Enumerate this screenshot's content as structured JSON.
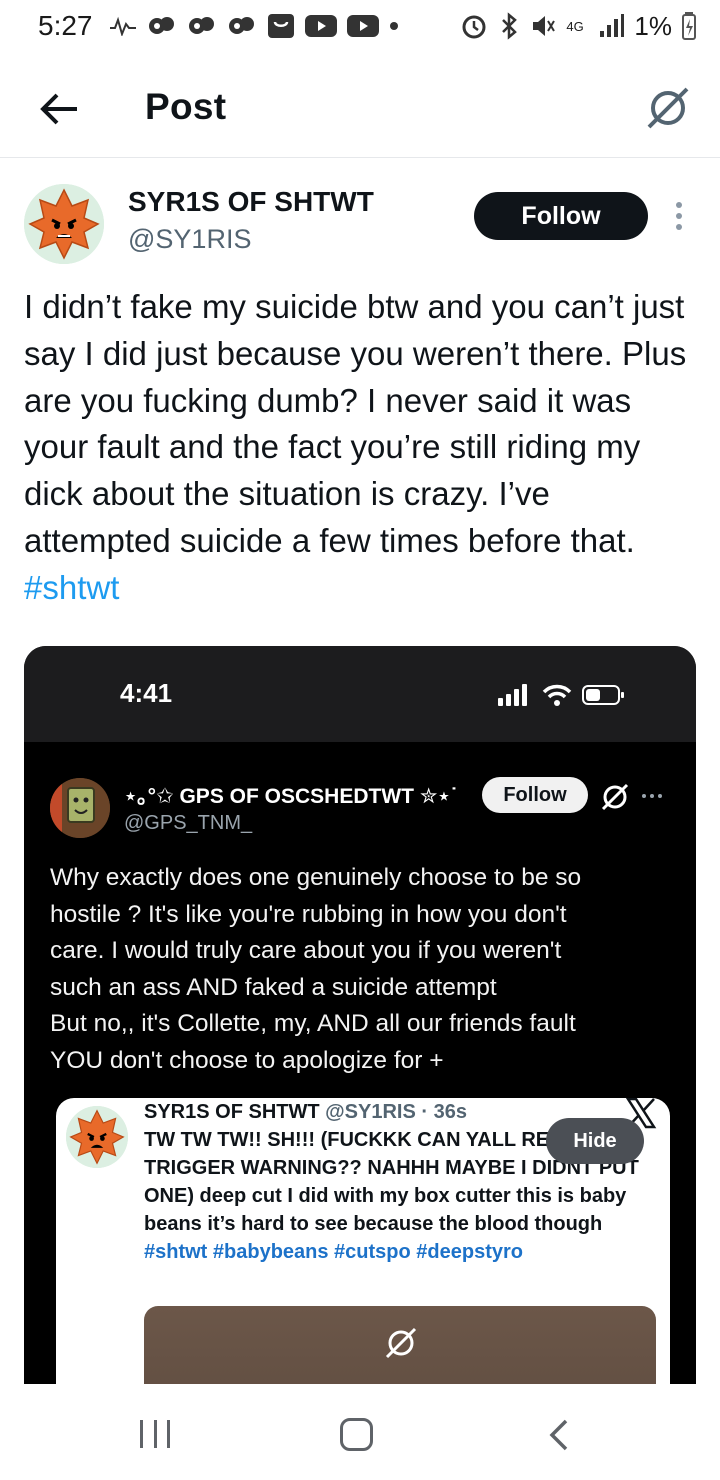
{
  "status_bar": {
    "time": "5:27",
    "network": "4G",
    "battery": "1%"
  },
  "header": {
    "title": "Post"
  },
  "post": {
    "author_name": "SYR1S OF SHTWT",
    "author_handle": "@SY1RIS",
    "follow_label": "Follow",
    "text": "I didn’t fake my suicide btw and you can’t just say I did just because you weren’t there. Plus are you fucking dumb? I never said it was your fault and the fact you’re still riding my dick about the situation is crazy. I’ve attempted suicide a few times before that. ",
    "hashtag": "#shtwt"
  },
  "embedded_screenshot": {
    "time": "4:41",
    "author_name": "⋆｡°✩ GPS OF OSCSHEDTWT ✮⋆˙",
    "author_handle": "@GPS_TNM_",
    "follow_label": "Follow",
    "text_lines": [
      "Why exactly does one genuinely choose to be so",
      "hostile ? It's like you're rubbing in how you don't",
      "care. I would truly care about you if you weren't",
      "such an ass AND faked a suicide attempt",
      "But no,, it's Collette, my, AND all our friends fault",
      "YOU don't choose to apologize for +"
    ],
    "quoted": {
      "author_name": "SYR1S OF SHTWT",
      "author_handle": "@SY1RIS",
      "time_ago": "· 36s",
      "text": "TW TW TW!! SH!!! (FUCKKK CAN YALL READ THE TRIGGER WARNING?? NAHHH MAYBE I DIDNT PUT ONE) deep cut I did with my box cutter this is baby beans it’s hard to see because the blood though ",
      "hashtags": "#shtwt #babybeans #cutspo #deepstyro",
      "hide_label": "Hide"
    }
  },
  "colors": {
    "accent": "#1d9bf0",
    "follow_bg": "#0f1419",
    "embed_bg": "#000000"
  },
  "icons": [
    "back-arrow-icon",
    "sensitive-content-icon",
    "more-icon",
    "x-logo-icon",
    "signal-icon",
    "wifi-icon",
    "battery-icon"
  ]
}
